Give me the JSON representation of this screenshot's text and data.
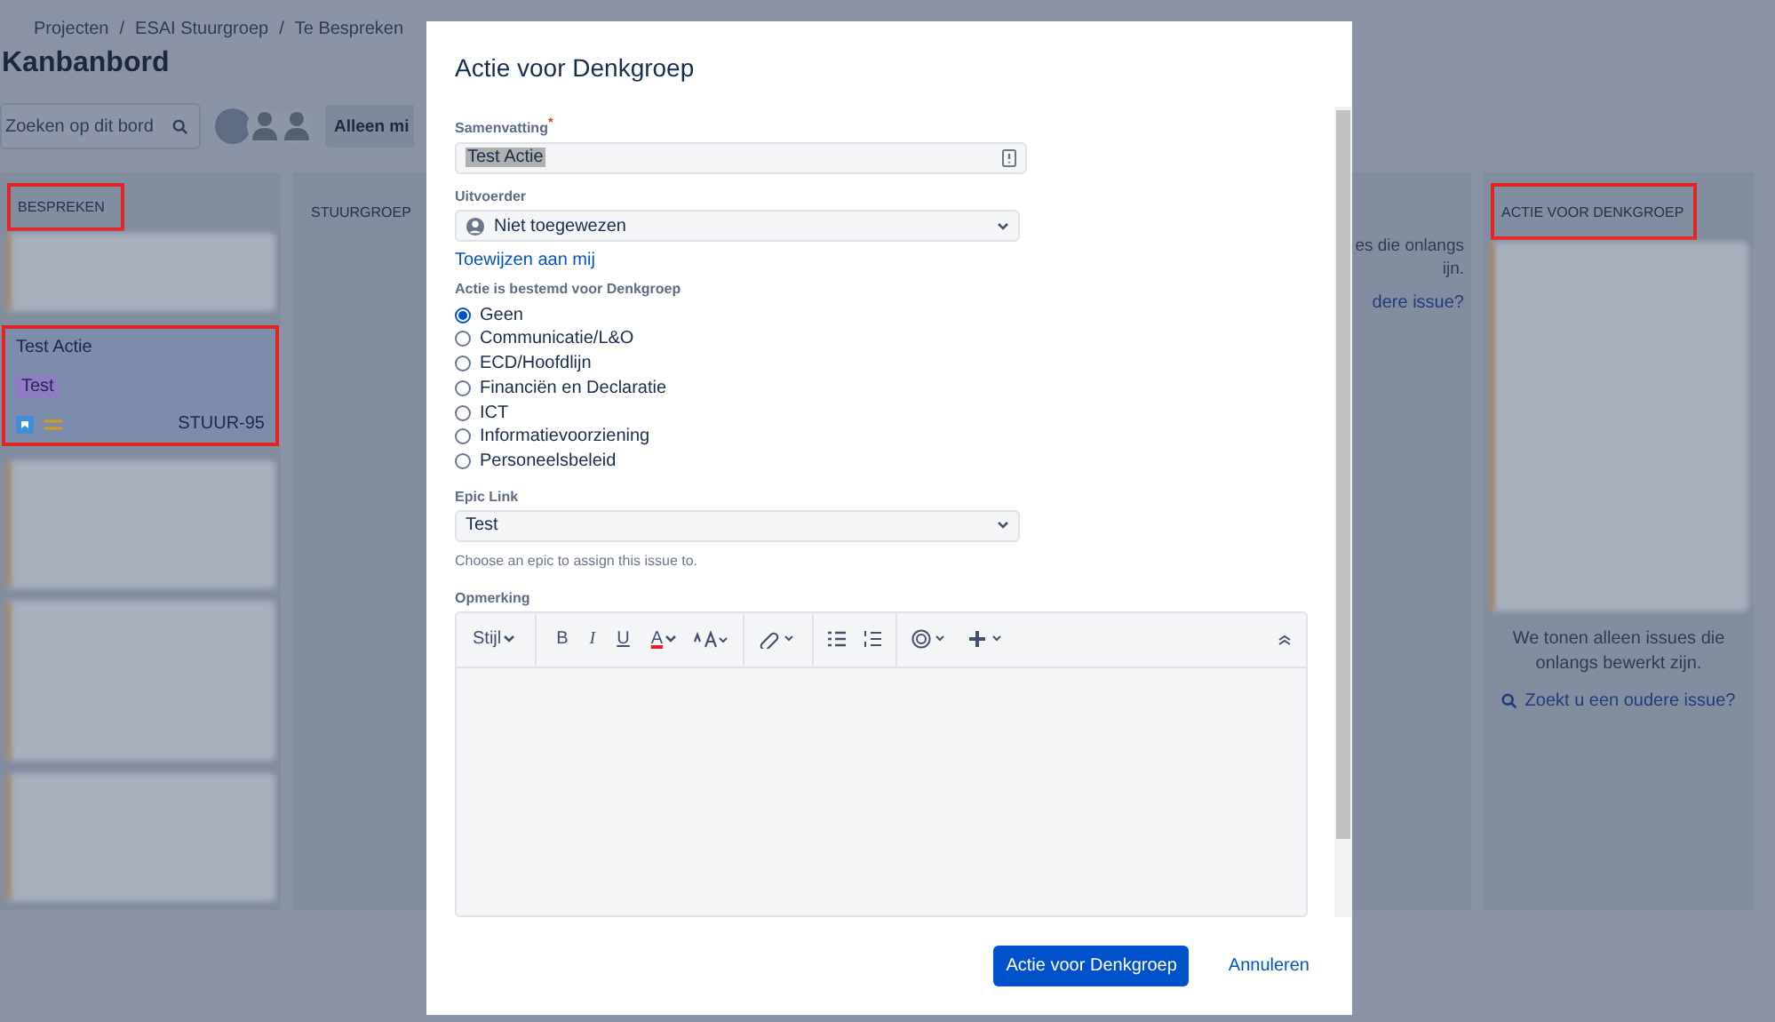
{
  "breadcrumbs": [
    "Projecten",
    "ESAI Stuurgroep",
    "Te Bespreken"
  ],
  "breadcrumb_separators": [
    "/",
    "/"
  ],
  "page_title": "Kanbanbord",
  "search": {
    "placeholder": "Zoeken op dit bord"
  },
  "filter_button": "Alleen mi",
  "columns": [
    {
      "title": "BESPREKEN",
      "highlighted": true,
      "cards": [
        {
          "kind": "blurred"
        },
        {
          "kind": "card",
          "title": "Test Actie",
          "label": "Test",
          "key": "STUUR-95",
          "highlighted": true
        },
        {
          "kind": "blurred"
        },
        {
          "kind": "blurred"
        },
        {
          "kind": "blurred"
        }
      ]
    },
    {
      "title": "STUURGROEP",
      "highlighted": false
    },
    {
      "note": "es die onlangs",
      "note_2": "ijn.",
      "link": "dere issue?"
    },
    {
      "title": "ACTIE VOOR DENKGROEP",
      "highlighted": true,
      "cards": [
        {
          "kind": "blurred"
        }
      ],
      "note": "We tonen alleen issues die onlangs bewerkt zijn.",
      "link": "Zoekt u een oudere issue?"
    }
  ],
  "modal": {
    "title": "Actie voor Denkgroep",
    "summary": {
      "label": "Samenvatting",
      "required_mark": "*",
      "value": "Test Actie"
    },
    "assignee": {
      "label": "Uitvoerder",
      "value": "Niet toegewezen",
      "link": "Toewijzen aan mij"
    },
    "group": {
      "label": "Actie is bestemd voor Denkgroep",
      "options": [
        {
          "label": "Geen",
          "selected": true
        },
        {
          "label": "Communicatie/L&O",
          "selected": false
        },
        {
          "label": "ECD/Hoofdlijn",
          "selected": false
        },
        {
          "label": "Financiën en Declaratie",
          "selected": false
        },
        {
          "label": "ICT",
          "selected": false
        },
        {
          "label": "Informatievoorziening",
          "selected": false
        },
        {
          "label": "Personeelsbeleid",
          "selected": false
        }
      ]
    },
    "epic": {
      "label": "Epic Link",
      "value": "Test",
      "help": "Choose an epic to assign this issue to."
    },
    "comment": {
      "label": "Opmerking",
      "style_menu": "Stijl",
      "format_buttons": [
        "B",
        "I",
        "U",
        "A"
      ]
    },
    "submit": "Actie voor Denkgroep",
    "cancel": "Annuleren"
  }
}
